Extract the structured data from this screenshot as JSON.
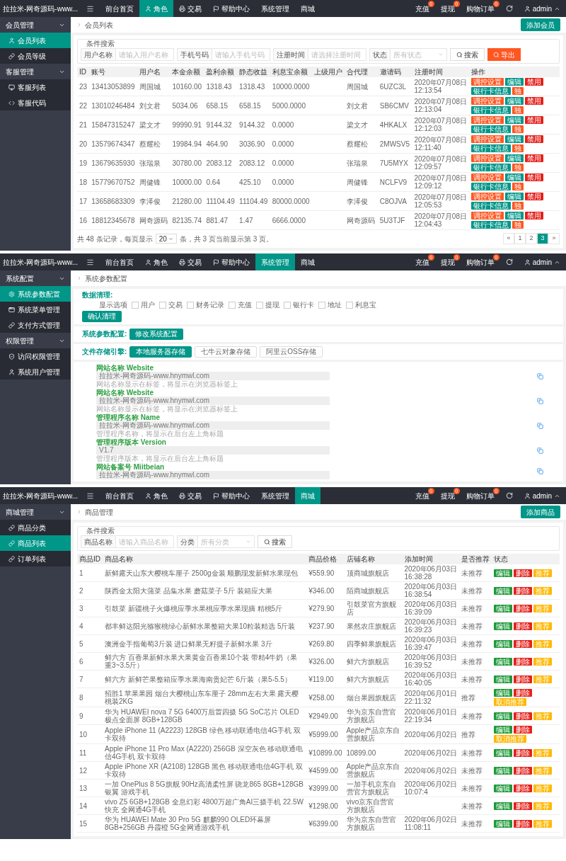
{
  "screens": [
    {
      "kind": "member_list",
      "topbar": {
        "logo": "拉拉米-网奇源码-www...",
        "nav": [
          {
            "label": "前台首页",
            "selected": false
          },
          {
            "label": "角色",
            "selected": true
          },
          {
            "label": "交易",
            "selected": false
          },
          {
            "label": "帮助中心",
            "selected": false
          },
          {
            "label": "系统管理",
            "selected": false
          },
          {
            "label": "商城",
            "selected": false
          }
        ],
        "shortcuts": [
          {
            "label": "充值",
            "badge": "0"
          },
          {
            "label": "提现",
            "badge": "0"
          },
          {
            "label": "购物订单",
            "badge": "0"
          }
        ],
        "user": "admin"
      },
      "sidebar": [
        {
          "label": "会员管理",
          "expanded": true,
          "items": [
            {
              "label": "会员列表",
              "selected": true
            },
            {
              "label": "会员等级",
              "selected": false
            }
          ]
        },
        {
          "label": "客服管理",
          "expanded": true,
          "items": [
            {
              "label": "客服列表",
              "selected": false
            },
            {
              "label": "客服代码",
              "selected": false
            }
          ]
        }
      ],
      "breadcrumb": "会员列表",
      "add_button": "添加会员",
      "search": {
        "legend": "条件搜索",
        "fields": [
          {
            "label": "用户名称",
            "placeholder": "请输入用户名称"
          },
          {
            "label": "手机号码",
            "placeholder": "请输入手机号码"
          },
          {
            "label": "注册时间",
            "placeholder": "请选择注册时间"
          }
        ],
        "select": {
          "label": "状态",
          "placeholder": "所有状态"
        },
        "search_button": "搜索",
        "export_button": "导出"
      },
      "table": {
        "columns": [
          "ID",
          "账号",
          "用户名",
          "本金余额",
          "盈利余额",
          "静态收益",
          "利息宝余额",
          "上级用户",
          "合代理",
          "邀请码",
          "注册时间",
          "操作"
        ],
        "rows": [
          {
            "id": "23",
            "account": "13413053899",
            "username": "周国城",
            "principal": "10160.00",
            "profit": "1318.43",
            "static_income": "1318.43",
            "interest": "10000.0000",
            "agent": "周国城",
            "invite": "6UZC3L",
            "registered": "2020年07月08日 12:13:54",
            "actions": [
              {
                "label": "调控设置",
                "kind": "warn"
              },
              {
                "label": "编辑",
                "kind": "primary"
              },
              {
                "label": "禁用",
                "kind": "danger"
              },
              {
                "label": "银行卡信息",
                "kind": "primary"
              },
              {
                "label": "独",
                "kind": "warn"
              }
            ]
          },
          {
            "id": "22",
            "account": "13010246484",
            "username": "刘文君",
            "principal": "5034.06",
            "profit": "658.15",
            "static_income": "658.15",
            "interest": "5000.0000",
            "agent": "刘文君",
            "invite": "SB6CMV",
            "registered": "2020年07月08日 12:13:04",
            "actions": [
              {
                "label": "调控设置",
                "kind": "warn"
              },
              {
                "label": "编辑",
                "kind": "primary"
              },
              {
                "label": "禁用",
                "kind": "danger"
              },
              {
                "label": "银行卡信息",
                "kind": "primary"
              },
              {
                "label": "独",
                "kind": "warn"
              }
            ]
          },
          {
            "id": "21",
            "account": "15847315247",
            "username": "梁文才",
            "principal": "99990.91",
            "profit": "9144.32",
            "static_income": "9144.32",
            "interest": "0.0000",
            "agent": "梁文才",
            "invite": "4HKALX",
            "registered": "2020年07月08日 12:12:03",
            "actions": [
              {
                "label": "调控设置",
                "kind": "warn"
              },
              {
                "label": "编辑",
                "kind": "primary"
              },
              {
                "label": "禁用",
                "kind": "danger"
              },
              {
                "label": "银行卡信息",
                "kind": "primary"
              },
              {
                "label": "独",
                "kind": "warn"
              }
            ]
          },
          {
            "id": "20",
            "account": "13579674347",
            "username": "蔡耀松",
            "principal": "19984.94",
            "profit": "464.90",
            "static_income": "3036.90",
            "interest": "0.0000",
            "agent": "蔡耀松",
            "invite": "2MWSV5",
            "registered": "2020年07月08日 12:11:40",
            "actions": [
              {
                "label": "调控设置",
                "kind": "warn"
              },
              {
                "label": "编辑",
                "kind": "primary"
              },
              {
                "label": "禁用",
                "kind": "danger"
              },
              {
                "label": "银行卡信息",
                "kind": "primary"
              },
              {
                "label": "独",
                "kind": "warn"
              }
            ]
          },
          {
            "id": "19",
            "account": "13679635930",
            "username": "张瑞泉",
            "principal": "30780.00",
            "profit": "2083.12",
            "static_income": "2083.12",
            "interest": "0.0000",
            "agent": "张瑞泉",
            "invite": "7U5MYX",
            "registered": "2020年07月08日 12:09:57",
            "actions": [
              {
                "label": "调控设置",
                "kind": "warn"
              },
              {
                "label": "编辑",
                "kind": "primary"
              },
              {
                "label": "禁用",
                "kind": "danger"
              },
              {
                "label": "银行卡信息",
                "kind": "primary"
              },
              {
                "label": "独",
                "kind": "warn"
              }
            ]
          },
          {
            "id": "18",
            "account": "15779670752",
            "username": "周健锋",
            "principal": "10000.00",
            "profit": "0.64",
            "static_income": "425.10",
            "interest": "0.0000",
            "agent": "周健锋",
            "invite": "NCLFV9",
            "registered": "2020年07月08日 12:09:12",
            "actions": [
              {
                "label": "调控设置",
                "kind": "warn"
              },
              {
                "label": "编辑",
                "kind": "primary"
              },
              {
                "label": "禁用",
                "kind": "danger"
              },
              {
                "label": "银行卡信息",
                "kind": "primary"
              },
              {
                "label": "独",
                "kind": "warn"
              }
            ]
          },
          {
            "id": "17",
            "account": "13658683309",
            "username": "李泽俊",
            "principal": "21280.00",
            "profit": "11104.49",
            "static_income": "11104.49",
            "interest": "80000.0000",
            "agent": "李泽俊",
            "invite": "C8OJVA",
            "registered": "2020年07月08日 12:05:53",
            "actions": [
              {
                "label": "调控设置",
                "kind": "warn"
              },
              {
                "label": "编辑",
                "kind": "primary"
              },
              {
                "label": "禁用",
                "kind": "danger"
              },
              {
                "label": "银行卡信息",
                "kind": "primary"
              },
              {
                "label": "独",
                "kind": "warn"
              }
            ]
          },
          {
            "id": "16",
            "account": "18812345678",
            "username": "网奇源码",
            "principal": "82135.74",
            "profit": "881.47",
            "static_income": "1.47",
            "interest": "6666.0000",
            "agent": "网奇源码",
            "invite": "5U3TJF",
            "registered": "2020年07月08日 12:04:43",
            "actions": [
              {
                "label": "调控设置",
                "kind": "warn"
              },
              {
                "label": "编辑",
                "kind": "primary"
              },
              {
                "label": "禁用",
                "kind": "danger"
              },
              {
                "label": "银行卡信息",
                "kind": "primary"
              },
              {
                "label": "独",
                "kind": "warn"
              }
            ]
          }
        ]
      },
      "footer": {
        "prefix": "共 48 条记录，每页显示",
        "page_size": "20",
        "suffix": "条，共 3 页当前显示第 3 页。"
      },
      "pagination": [
        {
          "label": "«",
          "selected": false
        },
        {
          "label": "1",
          "selected": false
        },
        {
          "label": "2",
          "selected": false
        },
        {
          "label": "3",
          "selected": true
        },
        {
          "label": "»",
          "selected": false
        }
      ]
    },
    {
      "kind": "system_config",
      "topbar": {
        "logo": "拉拉米-网奇源码-www...",
        "nav": [
          {
            "label": "前台首页",
            "selected": false
          },
          {
            "label": "角色",
            "selected": false
          },
          {
            "label": "交易",
            "selected": false
          },
          {
            "label": "帮助中心",
            "selected": false
          },
          {
            "label": "系统管理",
            "selected": true
          },
          {
            "label": "商城",
            "selected": false
          }
        ],
        "shortcuts": [
          {
            "label": "充值",
            "badge": "0"
          },
          {
            "label": "提现",
            "badge": "0"
          },
          {
            "label": "购物订单",
            "badge": "0"
          }
        ],
        "user": "admin"
      },
      "sidebar": [
        {
          "label": "系统配置",
          "expanded": true,
          "items": [
            {
              "label": "系统参数配置",
              "selected": true
            },
            {
              "label": "系统菜单管理",
              "selected": false
            },
            {
              "label": "支付方式管理",
              "selected": false
            }
          ]
        },
        {
          "label": "权限管理",
          "expanded": true,
          "items": [
            {
              "label": "访问权限管理",
              "selected": false
            },
            {
              "label": "系统用户管理",
              "selected": false
            }
          ]
        }
      ],
      "breadcrumb": "系统参数配置",
      "cleanup": {
        "label": "数据清理:",
        "options_label": "显示选项",
        "options": [
          {
            "label": "用户",
            "checked": false
          },
          {
            "label": "交易",
            "checked": false
          },
          {
            "label": "财务记录",
            "checked": false
          },
          {
            "label": "充值",
            "checked": false
          },
          {
            "label": "提现",
            "checked": false
          },
          {
            "label": "银行卡",
            "checked": false
          },
          {
            "label": "地址",
            "checked": false
          },
          {
            "label": "利息宝",
            "checked": false
          }
        ],
        "button": "确认清理"
      },
      "params": {
        "label": "系统参数配置:",
        "button": "修改系统配置"
      },
      "storage": {
        "label": "文件存储引擎:",
        "options": [
          {
            "label": "本地服务器存储",
            "selected": true
          },
          {
            "label": "七牛云对象存储",
            "selected": false
          },
          {
            "label": "阿里云OSS存储",
            "selected": false
          }
        ]
      },
      "settings": [
        {
          "title": "网站名称 Website",
          "value": "拉拉米-网奇源码-www.hnymwl.com",
          "hint": "网站名称显示在标签，将显示在浏览器标签上"
        },
        {
          "title": "网站名称 Website",
          "value": "拉拉米-网奇源码-www.hnymwl.com",
          "hint": "网站名称显示在标签，将显示在浏览器标签上"
        },
        {
          "title": "管理程序名称 Name",
          "value": "拉拉米-网奇源码-www.hnymwl.com",
          "hint": "管理程序名称，将显示在后台左上角标题"
        },
        {
          "title": "管理程序版本 Version",
          "value": "V1.7",
          "hint": "管理程序版本，将显示在后台左上角标题"
        },
        {
          "title": "网站备案号 Miitbeian",
          "value": "拉拉米-网奇源码-www.hnymwl.com"
        }
      ]
    },
    {
      "kind": "product_list",
      "topbar": {
        "logo": "拉拉米-网奇源码-www...",
        "nav": [
          {
            "label": "前台首页",
            "selected": false
          },
          {
            "label": "角色",
            "selected": false
          },
          {
            "label": "交易",
            "selected": false
          },
          {
            "label": "帮助中心",
            "selected": false
          },
          {
            "label": "系统管理",
            "selected": false
          },
          {
            "label": "商城",
            "selected": true
          }
        ],
        "shortcuts": [
          {
            "label": "充值",
            "badge": "0"
          },
          {
            "label": "提现",
            "badge": "0"
          },
          {
            "label": "购物订单",
            "badge": "0"
          }
        ],
        "user": "admin"
      },
      "sidebar": [
        {
          "label": "商城管理",
          "expanded": true,
          "items": [
            {
              "label": "商品分类",
              "selected": false
            },
            {
              "label": "商品列表",
              "selected": true
            },
            {
              "label": "订单列表",
              "selected": false
            }
          ]
        }
      ],
      "breadcrumb": "商品管理",
      "add_button": "添加商品",
      "search": {
        "legend": "条件搜索",
        "fields": [
          {
            "label": "商品名称",
            "placeholder": "请输入商品名称"
          }
        ],
        "select": {
          "label": "分类",
          "placeholder": "所有分类"
        },
        "search_button": "搜索"
      },
      "table": {
        "columns": [
          "商品ID",
          "商品名称",
          "商品价格",
          "店铺名称",
          "添加时间",
          "是否推荐",
          "状态"
        ],
        "rows": [
          {
            "id": "1",
            "name": "新鲜露天山东大樱桃车厘子 2500g金装 顺鹏现发新鲜水果现包",
            "price": "¥559.90",
            "shop": "顶商城旗舰店",
            "added": "2020年06月03日 16:38:28",
            "recommended": "未推荐",
            "actions": [
              {
                "label": "编辑",
                "kind": "success"
              },
              {
                "label": "删除",
                "kind": "danger"
              },
              {
                "label": "推荐",
                "kind": "caution"
              }
            ]
          },
          {
            "id": "2",
            "name": "陕西金太阳大蒲菜 品集水果 蘑菇菜子 5斤 装箱应大果",
            "price": "¥346.00",
            "shop": "陌商城旗舰店",
            "added": "2020年06月03日 16:38:54",
            "recommended": "未推荐",
            "actions": [
              {
                "label": "编辑",
                "kind": "success"
              },
              {
                "label": "删除",
                "kind": "danger"
              },
              {
                "label": "推荐",
                "kind": "caution"
              }
            ]
          },
          {
            "id": "3",
            "name": "引鼓菜 新疆桃子火爆桃应季水果桃应季水果现摘 精桃5斤",
            "price": "¥279.90",
            "shop": "引鼓菜官方旗舰店",
            "added": "2020年06月03日 16:39:09",
            "recommended": "未推荐",
            "actions": [
              {
                "label": "编辑",
                "kind": "success"
              },
              {
                "label": "删除",
                "kind": "danger"
              },
              {
                "label": "推荐",
                "kind": "caution"
              }
            ]
          },
          {
            "id": "4",
            "name": "都丰鲜达阳光猕猴桃绿心新鲜水果整箱大果10粒装精选 5斤装",
            "price": "¥237.90",
            "shop": "果然农庄旗舰店",
            "added": "2020年06月03日 16:39:23",
            "recommended": "未推荐",
            "actions": [
              {
                "label": "编辑",
                "kind": "success"
              },
              {
                "label": "删除",
                "kind": "danger"
              },
              {
                "label": "推荐",
                "kind": "caution"
              }
            ]
          },
          {
            "id": "5",
            "name": "澳洲金手指葡萄3斤装 进口鲜果无籽提子新鲜水果 3斤",
            "price": "¥269.80",
            "shop": "四季鲜果旗舰店",
            "added": "2020年06月03日 16:39:47",
            "recommended": "未推荐",
            "actions": [
              {
                "label": "编辑",
                "kind": "success"
              },
              {
                "label": "删除",
                "kind": "danger"
              },
              {
                "label": "推荐",
                "kind": "caution"
              }
            ]
          },
          {
            "id": "6",
            "name": "鲜六方 百香果新鲜水果大果黄金百香果10个装 带精4牛奶（果重3~3.5斤）",
            "price": "¥326.00",
            "shop": "鲜六方旗舰店",
            "added": "2020年06月03日 16:39:52",
            "recommended": "未推荐",
            "actions": [
              {
                "label": "编辑",
                "kind": "success"
              },
              {
                "label": "删除",
                "kind": "danger"
              },
              {
                "label": "推荐",
                "kind": "caution"
              }
            ]
          },
          {
            "id": "7",
            "name": "鲜六方 新鲜芒果整箱应季水果海南贵妃芒 6斤装（果5-5.5）",
            "price": "¥119.00",
            "shop": "鲜六方旗舰店",
            "added": "2020年06月03日 16:40:05",
            "recommended": "未推荐",
            "actions": [
              {
                "label": "编辑",
                "kind": "success"
              },
              {
                "label": "删除",
                "kind": "danger"
              },
              {
                "label": "推荐",
                "kind": "caution"
              }
            ]
          },
          {
            "id": "8",
            "name": "招胜1 苹果果园 烟台大樱桃山东车厘子 28mm左右大果 露天樱桃装2KG",
            "price": "¥258.00",
            "shop": "烟台果园旗舰店",
            "added": "2020年06月01日 22:11:32",
            "recommended": "推荐",
            "actions": [
              {
                "label": "编辑",
                "kind": "success"
              },
              {
                "label": "删除",
                "kind": "danger"
              },
              {
                "label": "取消推荐",
                "kind": "caution"
              }
            ]
          },
          {
            "id": "9",
            "name": "华为 HUAWEI nova 7 5G 6400万后置四摄 5G SoC芯片 OLED极点全面屏 8GB+128GB",
            "price": "¥2949.00",
            "shop": "华为京东自营官方旗舰店",
            "added": "2020年06月01日 22:19:34",
            "recommended": "未推荐",
            "actions": [
              {
                "label": "编辑",
                "kind": "success"
              },
              {
                "label": "删除",
                "kind": "danger"
              },
              {
                "label": "推荐",
                "kind": "caution"
              }
            ]
          },
          {
            "id": "10",
            "name": "Apple iPhone 11 (A2223) 128GB 绿色 移动联通电信4G手机 双卡双待",
            "price": "¥5999.00",
            "shop": "Apple产品京东自营旗舰店",
            "added": "2020年06月02日",
            "recommended": "推荐",
            "actions": [
              {
                "label": "编辑",
                "kind": "success"
              },
              {
                "label": "删除",
                "kind": "danger"
              },
              {
                "label": "取消推荐",
                "kind": "caution"
              }
            ]
          },
          {
            "id": "11",
            "name": "Apple iPhone 11 Pro Max (A2220) 256GB 深空灰色 移动联通电信4G手机 双卡双待",
            "price": "¥10899.00",
            "shop": "10899.00",
            "added": "2020年06月02日",
            "recommended": "未推荐",
            "actions": [
              {
                "label": "编辑",
                "kind": "success"
              },
              {
                "label": "删除",
                "kind": "danger"
              },
              {
                "label": "推荐",
                "kind": "caution"
              }
            ]
          },
          {
            "id": "12",
            "name": "Apple iPhone XR (A2108) 128GB 黑色 移动联通电信4G手机 双卡双待",
            "price": "¥4599.00",
            "shop": "Apple产品京东自营旗舰店",
            "added": "2020年06月02日",
            "recommended": "未推荐",
            "actions": [
              {
                "label": "编辑",
                "kind": "success"
              },
              {
                "label": "删除",
                "kind": "danger"
              },
              {
                "label": "推荐",
                "kind": "caution"
              }
            ]
          },
          {
            "id": "13",
            "name": "一加 OnePlus 8 5G旗舰 90Hz高清柔性屏 骁龙865 8GB+128GB 银翼 游戏手机",
            "price": "¥3999.00",
            "shop": "一加手机京东自营官方旗舰店",
            "added": "2020年06月02日 10:07:4",
            "recommended": "未推荐",
            "actions": [
              {
                "label": "编辑",
                "kind": "success"
              },
              {
                "label": "删除",
                "kind": "danger"
              },
              {
                "label": "推荐",
                "kind": "caution"
              }
            ]
          },
          {
            "id": "14",
            "name": "vivo Z5 6GB+128GB 全息幻彩 4800万超广角AI三摄手机 22.5W快充 全网通4G手机",
            "price": "¥1298.00",
            "shop": "vivo京东自营官方旗舰店",
            "recommended": "未推荐",
            "actions": [
              {
                "label": "编辑",
                "kind": "success"
              },
              {
                "label": "删除",
                "kind": "danger"
              },
              {
                "label": "推荐",
                "kind": "caution"
              }
            ]
          },
          {
            "id": "15",
            "name": "华为 HUAWEI Mate 30 Pro 5G 麒麟990 OLED环幕屏 8GB+256GB 丹霞橙 5G全网通游戏手机",
            "price": "¥6399.00",
            "shop": "华为京东自营官方旗舰店",
            "added": "2020年06月02日 11:08:11",
            "recommended": "未推荐",
            "actions": [
              {
                "label": "编辑",
                "kind": "success"
              },
              {
                "label": "删除",
                "kind": "danger"
              },
              {
                "label": "推荐",
                "kind": "caution"
              }
            ]
          }
        ]
      }
    }
  ]
}
